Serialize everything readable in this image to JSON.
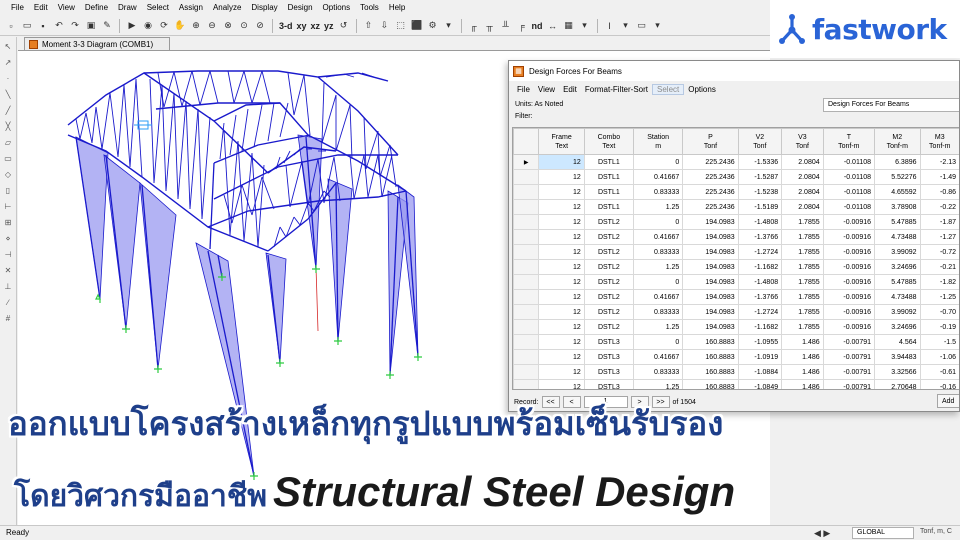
{
  "menubar": [
    "File",
    "Edit",
    "View",
    "Define",
    "Draw",
    "Select",
    "Assign",
    "Analyze",
    "Display",
    "Design",
    "Options",
    "Tools",
    "Help"
  ],
  "toolbar": {
    "view_labels": [
      "3-d",
      "xy",
      "xz",
      "yz"
    ],
    "nd_label": "nd"
  },
  "model_window": {
    "tab_title": "Moment 3-3 Diagram (COMB1)"
  },
  "dialog": {
    "title": "Design Forces For Beams",
    "menu": [
      "File",
      "View",
      "Edit",
      "Format-Filter-Sort",
      "Select",
      "Options"
    ],
    "units_label": "Units:  As Noted",
    "filter_label": "Filter:",
    "table_name": "Design Forces For Beams",
    "columns": [
      {
        "line1": "Frame",
        "line2": "Text"
      },
      {
        "line1": "Combo",
        "line2": "Text"
      },
      {
        "line1": "Station",
        "line2": "m"
      },
      {
        "line1": "P",
        "line2": "Tonf"
      },
      {
        "line1": "V2",
        "line2": "Tonf"
      },
      {
        "line1": "V3",
        "line2": "Tonf"
      },
      {
        "line1": "T",
        "line2": "Tonf-m"
      },
      {
        "line1": "M2",
        "line2": "Tonf-m"
      },
      {
        "line1": "M3",
        "line2": "Tonf-m"
      }
    ],
    "rows": [
      [
        "12",
        "DSTL1",
        "0",
        "225.2436",
        "-1.5336",
        "2.0804",
        "-0.01108",
        "6.3896",
        "-2.13"
      ],
      [
        "12",
        "DSTL1",
        "0.41667",
        "225.2436",
        "-1.5287",
        "2.0804",
        "-0.01108",
        "5.52276",
        "-1.49"
      ],
      [
        "12",
        "DSTL1",
        "0.83333",
        "225.2436",
        "-1.5238",
        "2.0804",
        "-0.01108",
        "4.65592",
        "-0.86"
      ],
      [
        "12",
        "DSTL1",
        "1.25",
        "225.2436",
        "-1.5189",
        "2.0804",
        "-0.01108",
        "3.78908",
        "-0.22"
      ],
      [
        "12",
        "DSTL2",
        "0",
        "194.0983",
        "-1.4808",
        "1.7855",
        "-0.00916",
        "5.47885",
        "-1.87"
      ],
      [
        "12",
        "DSTL2",
        "0.41667",
        "194.0983",
        "-1.3766",
        "1.7855",
        "-0.00916",
        "4.73488",
        "-1.27"
      ],
      [
        "12",
        "DSTL2",
        "0.83333",
        "194.0983",
        "-1.2724",
        "1.7855",
        "-0.00916",
        "3.99092",
        "-0.72"
      ],
      [
        "12",
        "DSTL2",
        "1.25",
        "194.0983",
        "-1.1682",
        "1.7855",
        "-0.00916",
        "3.24696",
        "-0.21"
      ],
      [
        "12",
        "DSTL2",
        "0",
        "194.0983",
        "-1.4808",
        "1.7855",
        "-0.00916",
        "5.47885",
        "-1.82"
      ],
      [
        "12",
        "DSTL2",
        "0.41667",
        "194.0983",
        "-1.3766",
        "1.7855",
        "-0.00916",
        "4.73488",
        "-1.25"
      ],
      [
        "12",
        "DSTL2",
        "0.83333",
        "194.0983",
        "-1.2724",
        "1.7855",
        "-0.00916",
        "3.99092",
        "-0.70"
      ],
      [
        "12",
        "DSTL2",
        "1.25",
        "194.0983",
        "-1.1682",
        "1.7855",
        "-0.00916",
        "3.24696",
        "-0.19"
      ],
      [
        "12",
        "DSTL3",
        "0",
        "160.8883",
        "-1.0955",
        "1.486",
        "-0.00791",
        "4.564",
        "-1.5"
      ],
      [
        "12",
        "DSTL3",
        "0.41667",
        "160.8883",
        "-1.0919",
        "1.486",
        "-0.00791",
        "3.94483",
        "-1.06"
      ],
      [
        "12",
        "DSTL3",
        "0.83333",
        "160.8883",
        "-1.0884",
        "1.486",
        "-0.00791",
        "3.32566",
        "-0.61"
      ],
      [
        "12",
        "DSTL3",
        "1.25",
        "160.8883",
        "-1.0849",
        "1.486",
        "-0.00791",
        "2.70648",
        "-0.16"
      ]
    ],
    "footer": {
      "record_label": "Record:",
      "first": "<<",
      "prev": "<",
      "current": "1",
      "next": ">",
      "last": ">>",
      "of_label": "of 1504",
      "add_label": "Add"
    }
  },
  "logo": {
    "text": "fastwork",
    "color": "#2a64d6"
  },
  "headline": {
    "line1": "ออกแบบโครงสร้างเหล็กทุกรูปแบบพร้อมเซ็นรับรอง",
    "line2_thai": "โดยวิศวกรมืออาชีพ",
    "line2_eng": "Structural Steel Design"
  },
  "status": {
    "text": "Ready",
    "coord_system": "GLOBAL",
    "units": "Tonf, m, C"
  },
  "colors": {
    "frame": "#1a1acc",
    "diagram_fill": "#9a9af0",
    "support": "#2ecc40",
    "headline": "#1e3f8a"
  }
}
